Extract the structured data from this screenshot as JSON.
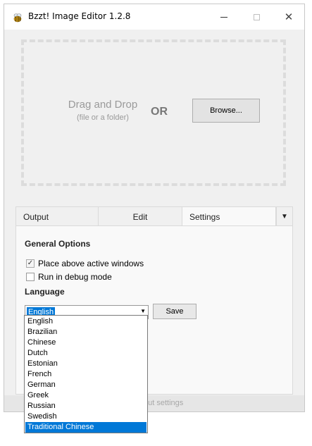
{
  "window": {
    "title": "Bzzt! Image Editor 1.2.8",
    "app_icon": "bee-icon",
    "controls": {
      "minimize": "minimize-icon",
      "maximize": "maximize-icon",
      "close": "✕"
    }
  },
  "drop_zone": {
    "title": "Drag and Drop",
    "subtitle": "(file or a folder)",
    "or_text": "OR",
    "browse_label": "Browse..."
  },
  "tabs": [
    {
      "label": "Output"
    },
    {
      "label": "Edit"
    },
    {
      "label": "Settings",
      "active": true
    }
  ],
  "settings": {
    "general_heading": "General Options",
    "options": [
      {
        "label": "Place above active windows",
        "checked": true
      },
      {
        "label": "Run in debug mode",
        "checked": false
      }
    ],
    "language_heading": "Language",
    "language_value": "English",
    "save_label": "Save"
  },
  "status_text": "out settings",
  "language_options": [
    "English",
    "Brazilian",
    "Chinese",
    "Dutch",
    "Estonian",
    "French",
    "German",
    "Greek",
    "Russian",
    "Swedish",
    "Traditional Chinese"
  ],
  "highlighted_option": "Traditional Chinese",
  "colors": {
    "accent": "#0078d7",
    "dashed_border": "#dcdcdc",
    "window_bg": "#f0f0f0"
  }
}
